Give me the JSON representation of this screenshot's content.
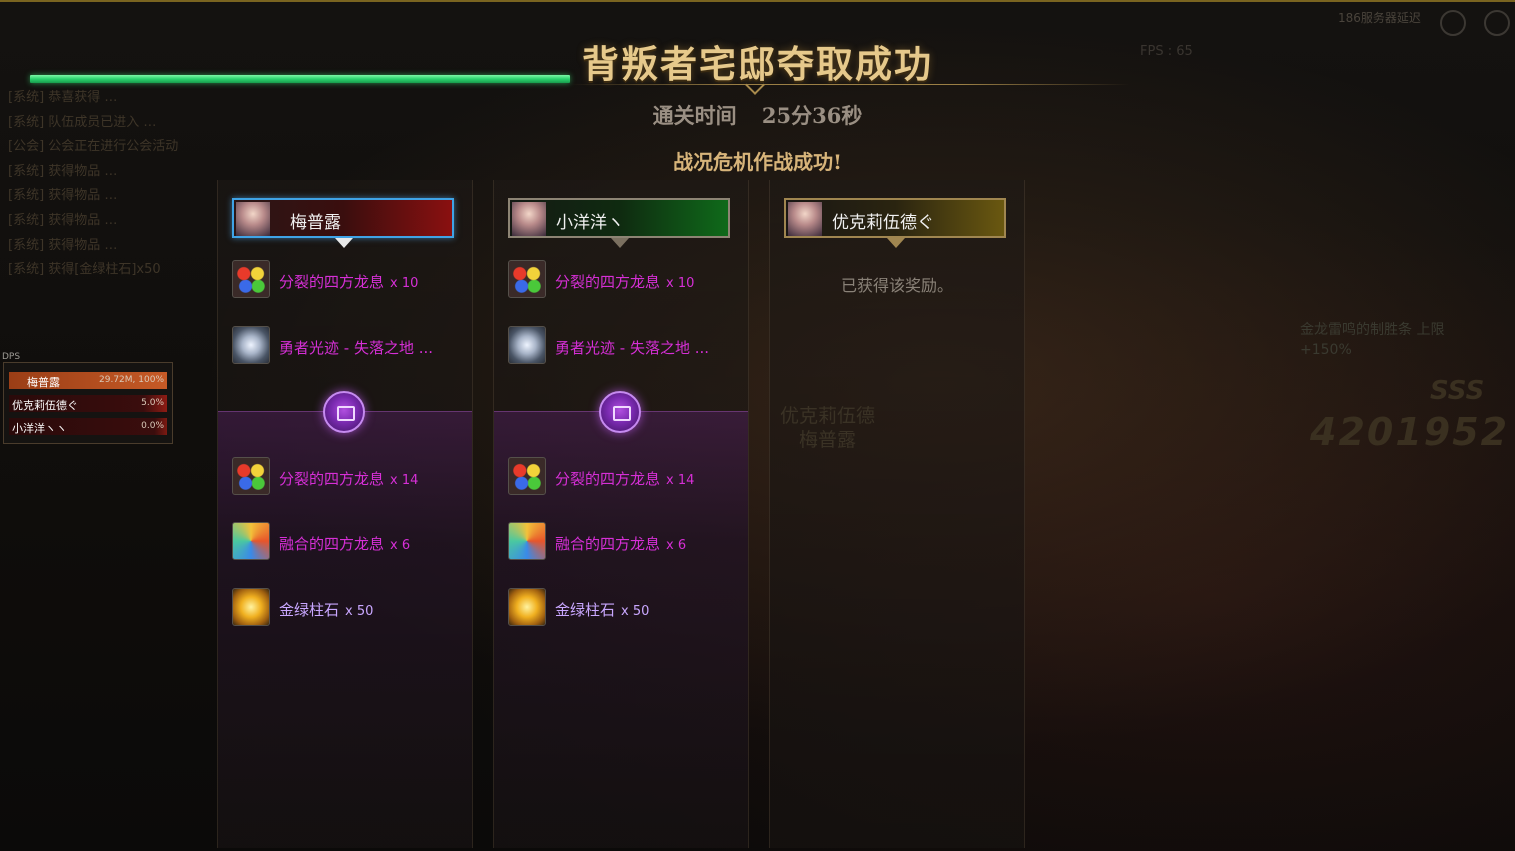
{
  "hud": {
    "fps": "FPS : 65",
    "server": "186服务器延迟",
    "chat_lines": [
      "[系统] 恭喜获得 …",
      "[系统] 队伍成员已进入 …",
      "[公会] 公会正在进行公会活动",
      "[系统] 获得物品 …",
      "[系统] 获得物品 …",
      "[系统] 获得物品 …",
      "[系统] 获得物品 …",
      "[系统] 获得[金绿柱石]x50"
    ],
    "score_rank": "SSS",
    "score": "4201952",
    "buff_lines": [
      "金龙雷鸣的制胜条 上限",
      "+150%"
    ]
  },
  "dps": {
    "tag": "DPS",
    "rows": [
      {
        "name": "梅普露",
        "value": "29.72M, 100%"
      },
      {
        "name": "优克莉伍德ぐ",
        "value": "5.0%"
      },
      {
        "name": "小洋洋ヽヽ",
        "value": "0.0%"
      }
    ]
  },
  "result": {
    "title": "背叛者宅邸夺取成功",
    "clear_time_label": "通关时间",
    "clear_time_value": "25分36秒",
    "subtitle": "战况危机作战成功!"
  },
  "players": [
    {
      "name": "梅普露",
      "base_rewards": [
        {
          "name": "分裂的四方龙息",
          "qty": "x 10",
          "icon": "dragon-breath-icon"
        },
        {
          "name": "勇者光迹 - 失落之地 ...",
          "qty": "",
          "icon": "hero-trace-icon"
        }
      ],
      "bonus_rewards": [
        {
          "name": "分裂的四方龙息",
          "qty": "x 14",
          "icon": "dragon-breath-icon"
        },
        {
          "name": "融合的四方龙息",
          "qty": "x 6",
          "icon": "fusion-breath-icon"
        },
        {
          "name": "金绿柱石",
          "qty": "x 50",
          "icon": "chrysoberyl-icon"
        }
      ]
    },
    {
      "name": "小洋洋ヽ",
      "base_rewards": [
        {
          "name": "分裂的四方龙息",
          "qty": "x 10",
          "icon": "dragon-breath-icon"
        },
        {
          "name": "勇者光迹 - 失落之地 ...",
          "qty": "",
          "icon": "hero-trace-icon"
        }
      ],
      "bonus_rewards": [
        {
          "name": "分裂的四方龙息",
          "qty": "x 14",
          "icon": "dragon-breath-icon"
        },
        {
          "name": "融合的四方龙息",
          "qty": "x 6",
          "icon": "fusion-breath-icon"
        },
        {
          "name": "金绿柱石",
          "qty": "x 50",
          "icon": "chrysoberyl-icon"
        }
      ]
    },
    {
      "name": "优克莉伍德ぐ",
      "claimed_text": "已获得该奖励。"
    }
  ],
  "ghost_names": [
    "优克莉伍德",
    "梅普露"
  ],
  "colors": {
    "accent_gold": "#e6c98b",
    "item_magenta": "#d62fd6",
    "item_lavender": "#c9a7ff",
    "hp_green": "#2bd36e"
  }
}
